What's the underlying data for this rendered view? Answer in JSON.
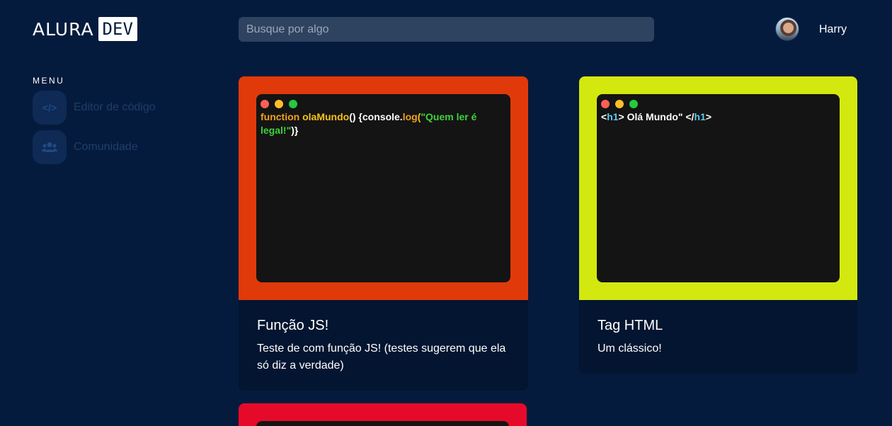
{
  "header": {
    "logo_text": "ALURA",
    "logo_badge": "DEV",
    "search_placeholder": "Busque por algo",
    "username": "Harry"
  },
  "sidebar": {
    "menu_label": "MENU",
    "items": [
      {
        "label": "Editor de código",
        "icon": "code-icon",
        "glyph": "</>"
      },
      {
        "label": "Comunidade",
        "icon": "users-icon",
        "glyph": "👥"
      }
    ]
  },
  "colors": {
    "background": "#051b3d",
    "card1": "#e13a0a",
    "card2": "#d3e80f",
    "card3": "#e60a2a",
    "dot_red": "#ff5f56",
    "dot_yellow": "#ffbd2e",
    "dot_green": "#27c93f"
  },
  "cards": [
    {
      "title": "Função JS!",
      "description": "Teste de com função JS! (testes sugerem que ela só diz a verdade)",
      "code": {
        "kw": "function ",
        "fn": "olaMundo",
        "p1": "() {",
        "obj": "console",
        "dot": ".",
        "method": "log",
        "p2": "(",
        "str": "\"Quem ler é legal!\"",
        "p3": ")}"
      }
    },
    {
      "title": "Tag HTML",
      "description": "Um clássico!",
      "code": {
        "lt1": "<",
        "tag1": "h1",
        "gt1": "> Olá Mundo\" </",
        "tag2": "h1",
        "gt2": ">"
      }
    }
  ]
}
